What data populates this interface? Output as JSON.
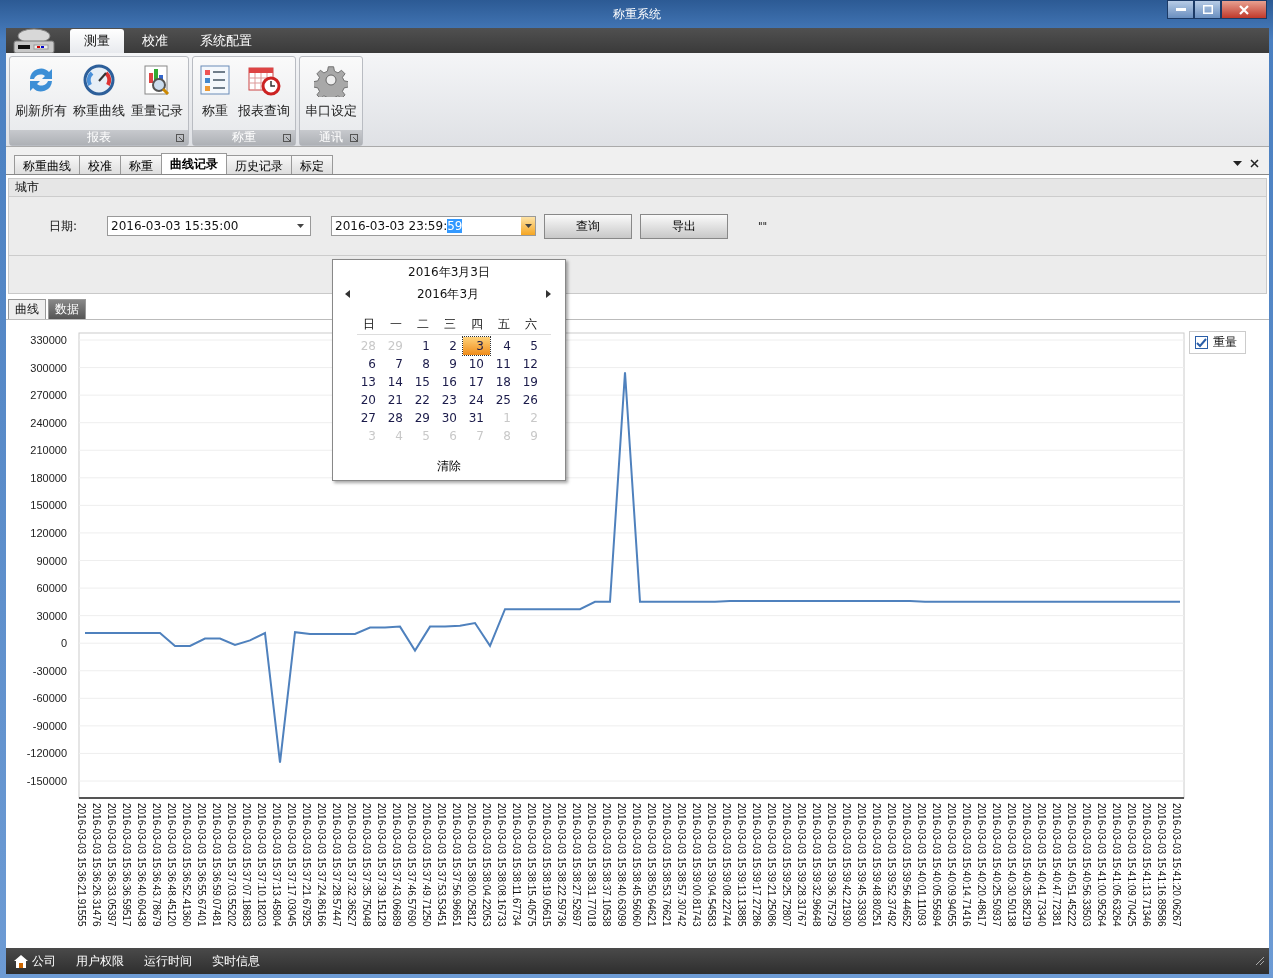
{
  "window": {
    "title": "称重系统"
  },
  "ribbon": {
    "tabs": [
      {
        "label": "测量",
        "selected": true
      },
      {
        "label": "校准",
        "selected": false
      },
      {
        "label": "系统配置",
        "selected": false
      }
    ],
    "groups": [
      {
        "title": "报表",
        "buttons": [
          {
            "label": "刷新所有",
            "kind": "refresh"
          },
          {
            "label": "称重曲线",
            "kind": "gauge"
          },
          {
            "label": "重量记录",
            "kind": "report"
          }
        ]
      },
      {
        "title": "称重",
        "buttons": [
          {
            "label": "称重",
            "kind": "list"
          },
          {
            "label": "报表查询",
            "kind": "calendar"
          }
        ]
      },
      {
        "title": "通讯",
        "buttons": [
          {
            "label": "串口设定",
            "kind": "gear"
          }
        ]
      }
    ]
  },
  "document_tabs": [
    {
      "label": "称重曲线",
      "selected": false
    },
    {
      "label": "校准",
      "selected": false
    },
    {
      "label": "称重",
      "selected": false
    },
    {
      "label": "曲线记录",
      "selected": true
    },
    {
      "label": "历史记录",
      "selected": false
    },
    {
      "label": "标定",
      "selected": false
    }
  ],
  "filter_panel": {
    "title": "城市",
    "date_label": "日期:",
    "start": "2016-03-03 15:35:00",
    "end_value": "2016-03-03 23:59:",
    "end_selected_part": "59",
    "buttons": [
      "查询",
      "导出"
    ],
    "note": "\"\""
  },
  "calendar": {
    "header": "2016年3月3日",
    "month": "2016年3月",
    "weekdays": [
      "日",
      "一",
      "二",
      "三",
      "四",
      "五",
      "六"
    ],
    "weeks": [
      [
        {
          "day": "28",
          "other_month": true,
          "selected": false
        },
        {
          "day": "29",
          "other_month": true,
          "selected": false
        },
        {
          "day": "1",
          "other_month": false,
          "selected": false
        },
        {
          "day": "2",
          "other_month": false,
          "selected": false
        },
        {
          "day": "3",
          "other_month": false,
          "selected": true
        },
        {
          "day": "4",
          "other_month": false,
          "selected": false
        },
        {
          "day": "5",
          "other_month": false,
          "selected": false
        }
      ],
      [
        {
          "day": "6",
          "other_month": false,
          "selected": false
        },
        {
          "day": "7",
          "other_month": false,
          "selected": false
        },
        {
          "day": "8",
          "other_month": false,
          "selected": false
        },
        {
          "day": "9",
          "other_month": false,
          "selected": false
        },
        {
          "day": "10",
          "other_month": false,
          "selected": false
        },
        {
          "day": "11",
          "other_month": false,
          "selected": false
        },
        {
          "day": "12",
          "other_month": false,
          "selected": false
        }
      ],
      [
        {
          "day": "13",
          "other_month": false,
          "selected": false
        },
        {
          "day": "14",
          "other_month": false,
          "selected": false
        },
        {
          "day": "15",
          "other_month": false,
          "selected": false
        },
        {
          "day": "16",
          "other_month": false,
          "selected": false
        },
        {
          "day": "17",
          "other_month": false,
          "selected": false
        },
        {
          "day": "18",
          "other_month": false,
          "selected": false
        },
        {
          "day": "19",
          "other_month": false,
          "selected": false
        }
      ],
      [
        {
          "day": "20",
          "other_month": false,
          "selected": false
        },
        {
          "day": "21",
          "other_month": false,
          "selected": false
        },
        {
          "day": "22",
          "other_month": false,
          "selected": false
        },
        {
          "day": "23",
          "other_month": false,
          "selected": false
        },
        {
          "day": "24",
          "other_month": false,
          "selected": false
        },
        {
          "day": "25",
          "other_month": false,
          "selected": false
        },
        {
          "day": "26",
          "other_month": false,
          "selected": false
        }
      ],
      [
        {
          "day": "27",
          "other_month": false,
          "selected": false
        },
        {
          "day": "28",
          "other_month": false,
          "selected": false
        },
        {
          "day": "29",
          "other_month": false,
          "selected": false
        },
        {
          "day": "30",
          "other_month": false,
          "selected": false
        },
        {
          "day": "31",
          "other_month": false,
          "selected": false
        },
        {
          "day": "1",
          "other_month": true,
          "selected": false
        },
        {
          "day": "2",
          "other_month": true,
          "selected": false
        }
      ],
      [
        {
          "day": "3",
          "other_month": true,
          "selected": false
        },
        {
          "day": "4",
          "other_month": true,
          "selected": false
        },
        {
          "day": "5",
          "other_month": true,
          "selected": false
        },
        {
          "day": "6",
          "other_month": true,
          "selected": false
        },
        {
          "day": "7",
          "other_month": true,
          "selected": false
        },
        {
          "day": "8",
          "other_month": true,
          "selected": false
        },
        {
          "day": "9",
          "other_month": true,
          "selected": false
        }
      ]
    ],
    "clear": "清除"
  },
  "view_tabs": [
    {
      "label": "曲线",
      "selected": true
    },
    {
      "label": "数据",
      "selected": false
    }
  ],
  "chart": {
    "legend": {
      "checked": true
    },
    "chart_data": {
      "type": "line",
      "categories": [
        "2016-03-03 15:36:21.91555",
        "2016-03-03 15:36:26.31476",
        "2016-03-03 15:36:33.05397",
        "2016-03-03 15:36:36.59517",
        "2016-03-03 15:36:40.60438",
        "2016-03-03 15:36:43.78679",
        "2016-03-03 15:36:48.45120",
        "2016-03-03 15:36:52.41360",
        "2016-03-03 15:36:55.67401",
        "2016-03-03 15:36:59.07481",
        "2016-03-03 15:37:03.55202",
        "2016-03-03 15:37:07.18683",
        "2016-03-03 15:37:10.18203",
        "2016-03-03 15:37:13.45804",
        "2016-03-03 15:37:17.03045",
        "2016-03-03 15:37:21.67925",
        "2016-03-03 15:37:24.86166",
        "2016-03-03 15:37:28.57447",
        "2016-03-03 15:37:32.36527",
        "2016-03-03 15:37:35.75048",
        "2016-03-03 15:37:39.15128",
        "2016-03-03 15:37:43.06689",
        "2016-03-03 15:37:46.57690",
        "2016-03-03 15:37:49.71250",
        "2016-03-03 15:37:53.53451",
        "2016-03-03 15:37:56.96651",
        "2016-03-03 15:38:00.25812",
        "2016-03-03 15:38:04.22053",
        "2016-03-03 15:38:08.16733",
        "2016-03-03 15:38:11.67734",
        "2016-03-03 15:38:15.40575",
        "2016-03-03 15:38:19.05615",
        "2016-03-03 15:38:22.59736",
        "2016-03-03 15:38:27.52697",
        "2016-03-03 15:38:31.77018",
        "2016-03-03 15:38:37.10538",
        "2016-03-03 15:38:40.63099",
        "2016-03-03 15:38:45.56060",
        "2016-03-03 15:38:50.64621",
        "2016-03-03 15:38:53.76621",
        "2016-03-03 15:38:57.30742",
        "2016-03-03 15:39:00.81743",
        "2016-03-03 15:39:04.54583",
        "2016-03-03 15:39:08.22744",
        "2016-03-03 15:39:13.13885",
        "2016-03-03 15:39:17.27286",
        "2016-03-03 15:39:21.25086",
        "2016-03-03 15:39:25.72807",
        "2016-03-03 15:39:28.31767",
        "2016-03-03 15:39:32.96648",
        "2016-03-03 15:39:36.75729",
        "2016-03-03 15:39:42.21930",
        "2016-03-03 15:39:45.33930",
        "2016-03-03 15:39:48.80251",
        "2016-03-03 15:39:52.37492",
        "2016-03-03 15:39:56.44652",
        "2016-03-03 15:40:01.11093",
        "2016-03-03 15:40:05.55694",
        "2016-03-03 15:40:09.94055",
        "2016-03-03 15:40:14.71416",
        "2016-03-03 15:40:20.48617",
        "2016-03-03 15:40:25.50937",
        "2016-03-03 15:40:30.50138",
        "2016-03-03 15:40:35.85219",
        "2016-03-03 15:40:41.73340",
        "2016-03-03 15:40:47.72381",
        "2016-03-03 15:40:51.45222",
        "2016-03-03 15:40:56.33503",
        "2016-03-03 15:41:00.95264",
        "2016-03-03 15:41:05.63264",
        "2016-03-03 15:41:09.70425",
        "2016-03-03 15:41:13.71346",
        "2016-03-03 15:41:16.89586",
        "2016-03-03 15:41:20.06267"
      ],
      "series": [
        {
          "name": "重量",
          "color": "#4f81bd",
          "values": [
            11000,
            11000,
            11000,
            11000,
            11000,
            11000,
            -3000,
            -3000,
            5000,
            5000,
            -2000,
            3000,
            11000,
            -130000,
            12000,
            10000,
            10000,
            10000,
            10000,
            17000,
            17000,
            18000,
            -8000,
            18000,
            18000,
            19000,
            22000,
            -3000,
            37000,
            37000,
            37000,
            37000,
            37000,
            37000,
            45000,
            45000,
            295000,
            45000,
            45000,
            45000,
            45000,
            45000,
            45000,
            46000,
            46000,
            46000,
            46000,
            46000,
            46000,
            46000,
            46000,
            46000,
            46000,
            46000,
            46000,
            46000,
            45000,
            45000,
            45000,
            45000,
            45000,
            45000,
            45000,
            45000,
            45000,
            45000,
            45000,
            45000,
            45000,
            45000,
            45000,
            45000,
            45000,
            45000
          ]
        }
      ],
      "ylim": [
        -150000,
        330000
      ],
      "grid": true,
      "yticks": [
        -150000,
        -120000,
        -90000,
        -60000,
        -30000,
        0,
        30000,
        60000,
        90000,
        120000,
        150000,
        180000,
        210000,
        240000,
        270000,
        300000,
        330000
      ]
    }
  },
  "status_bar": [
    "公司",
    "用户权限",
    "运行时间",
    "实时信息"
  ]
}
